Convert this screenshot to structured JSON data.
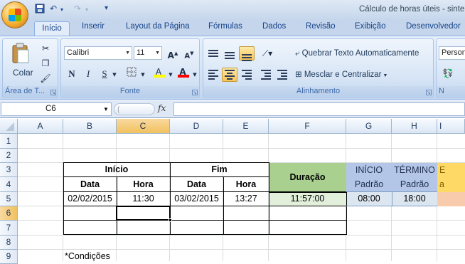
{
  "window": {
    "title": "Cálculo de horas úteis - sinte"
  },
  "quick_access": {
    "save_icon": "save-icon",
    "undo_icon": "undo-icon",
    "redo_icon": "redo-icon",
    "customize_icon": "customize-icon"
  },
  "tabs": [
    "Início",
    "Inserir",
    "Layout da Página",
    "Fórmulas",
    "Dados",
    "Revisão",
    "Exibição",
    "Desenvolvedor"
  ],
  "ribbon": {
    "clipboard": {
      "label": "Área de T...",
      "paste": "Colar"
    },
    "font": {
      "label": "Fonte",
      "name": "Calibri",
      "size": "11",
      "grow": "A",
      "shrink": "A",
      "bold": "N",
      "italic": "I",
      "underline": "S",
      "fill_letter": "A",
      "color_letter": "A",
      "fill_color": "#ffff00",
      "font_color": "#ff0000"
    },
    "alignment": {
      "label": "Alinhamento",
      "wrap": "Quebrar Texto Automaticamente",
      "merge": "Mesclar e Centralizar"
    },
    "number": {
      "format": "Person"
    }
  },
  "formula_bar": {
    "name_box": "C6",
    "fx": "fx",
    "value": ""
  },
  "sheet": {
    "columns": [
      "A",
      "B",
      "C",
      "D",
      "E",
      "F",
      "G",
      "H",
      "I"
    ],
    "rows": [
      "1",
      "2",
      "3",
      "4",
      "5",
      "6",
      "7",
      "8",
      "9"
    ],
    "selected_cell": "C6",
    "header_inicio": "Início",
    "header_fim": "Fim",
    "header_duracao": "Duração",
    "sub_data_1": "Data",
    "sub_hora_1": "Hora",
    "sub_data_2": "Data",
    "sub_hora_2": "Hora",
    "inicio_padrao_1": "INÍCIO",
    "inicio_padrao_2": "Padrão",
    "termino_padrao_1": "TÉRMINO",
    "termino_padrao_2": "Padrão",
    "col_i_3": "E",
    "col_i_4": "a",
    "row5": {
      "data_inicio": "02/02/2015",
      "hora_inicio": "11:30",
      "data_fim": "03/02/2015",
      "hora_fim": "13:27",
      "duracao": "11:57:00",
      "inicio": "08:00",
      "termino": "18:00"
    },
    "row9": "*Condições",
    "colors": {
      "duracao_fill": "#a9d08e",
      "duracao_value_fill": "#e2efda",
      "padrao_fill": "#b4c6e7",
      "padrao_value_fill": "#dce6f1",
      "col_i_fill": "#ffd966"
    }
  }
}
